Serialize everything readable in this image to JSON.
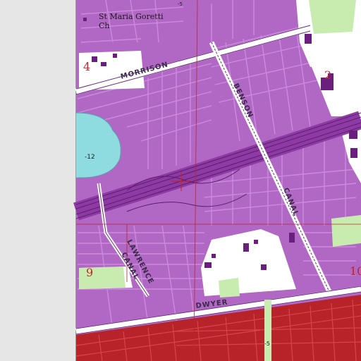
{
  "map": {
    "colors": {
      "margin": "#e6e6e6",
      "urban": "#b168c4",
      "street": "#cf8ee0",
      "roadline": "#6a2a7e",
      "water": "#8fdce0",
      "park": "#c8ecb0",
      "dense": "#b8232a",
      "grid_red": "#d9434b",
      "open": "#ffffff"
    },
    "labels": {
      "church_line1": "St Maria Goretti",
      "church_line2": "Ch",
      "morrison": "MORRISON",
      "benson": "BENSON",
      "canal_east": "CANAL",
      "lawrence": "LAWRENCE",
      "canal_lawrence": "CANAL",
      "dwyer": "DWYER",
      "contour_lake": "-12",
      "contour_bottom": "-5",
      "contour_top": "-5"
    },
    "sections": {
      "s4": "4",
      "s2": "2",
      "s9": "9",
      "s10": "10"
    }
  }
}
